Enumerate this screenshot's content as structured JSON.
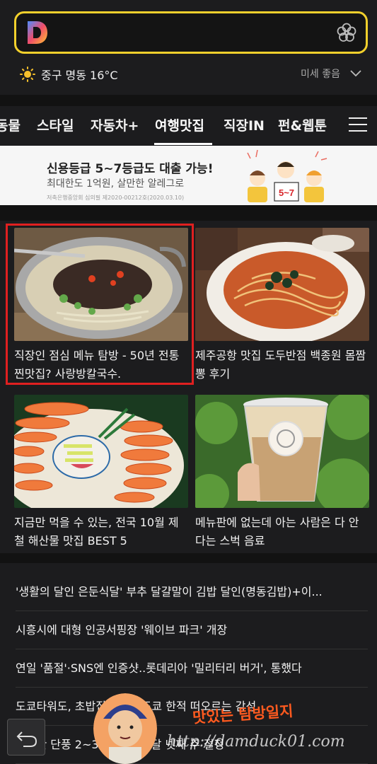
{
  "header": {
    "logo_icon": "daum-d-logo-icon",
    "flower_icon": "flower-icon"
  },
  "weather": {
    "icon": "sun-icon",
    "text": "중구 명동 16°C",
    "dust_label": "미세 좋음"
  },
  "tabs": [
    {
      "label": "동물"
    },
    {
      "label": "스타일"
    },
    {
      "label": "자동차+"
    },
    {
      "label": "여행맛집",
      "active": true
    },
    {
      "label": "직장IN"
    },
    {
      "label": "펀&웹툰"
    }
  ],
  "ad": {
    "title": "신용등급 5~7등급도 대출 가능!",
    "subtitle": "최대한도 1억원, 살만한 알레그로",
    "small": "저축은행중앙회 심의필 제2020-00212호(2020.03.10)",
    "badge": "5~7"
  },
  "cards": [
    {
      "title": "직장인 점심 메뉴 탐방 - 50년 전통 찐맛집? 사랑방칼국수."
    },
    {
      "title": "제주공항 맛집 도두반점 백종원 몸짬뽕 후기"
    },
    {
      "title": "지금만 먹을 수 있는, 전국 10월 제철 해산물 맛집 BEST 5"
    },
    {
      "title": "메뉴판에 없는데 아는 사람은 다 안다는 스벅 음료"
    }
  ],
  "news": [
    {
      "title": "'생활의 달인 은둔식달' 부추 달걀말이 김밥 달인(명동김밥)+이..."
    },
    {
      "title": "시흥시에 대형 인공서핑장 '웨이브 파크' 개장"
    },
    {
      "title": "연일 '품절'·SNS엔 인증샷..롯데리아 '밀리터리 버거', 통했다"
    },
    {
      "title": "도쿄타워도, 초밥집도 다.. 도쿄 한적 떠오르는 감성"
    },
    {
      "title": "설악산 단풍 2~3일 시작..이달 넷째 주 절정"
    }
  ],
  "watermark": {
    "name": "맛있는 탐방일지",
    "url": "http://damduck01.com"
  },
  "colors": {
    "search_border": "#f2d02c",
    "highlight": "#e02020",
    "background": "#1c1c1e"
  }
}
